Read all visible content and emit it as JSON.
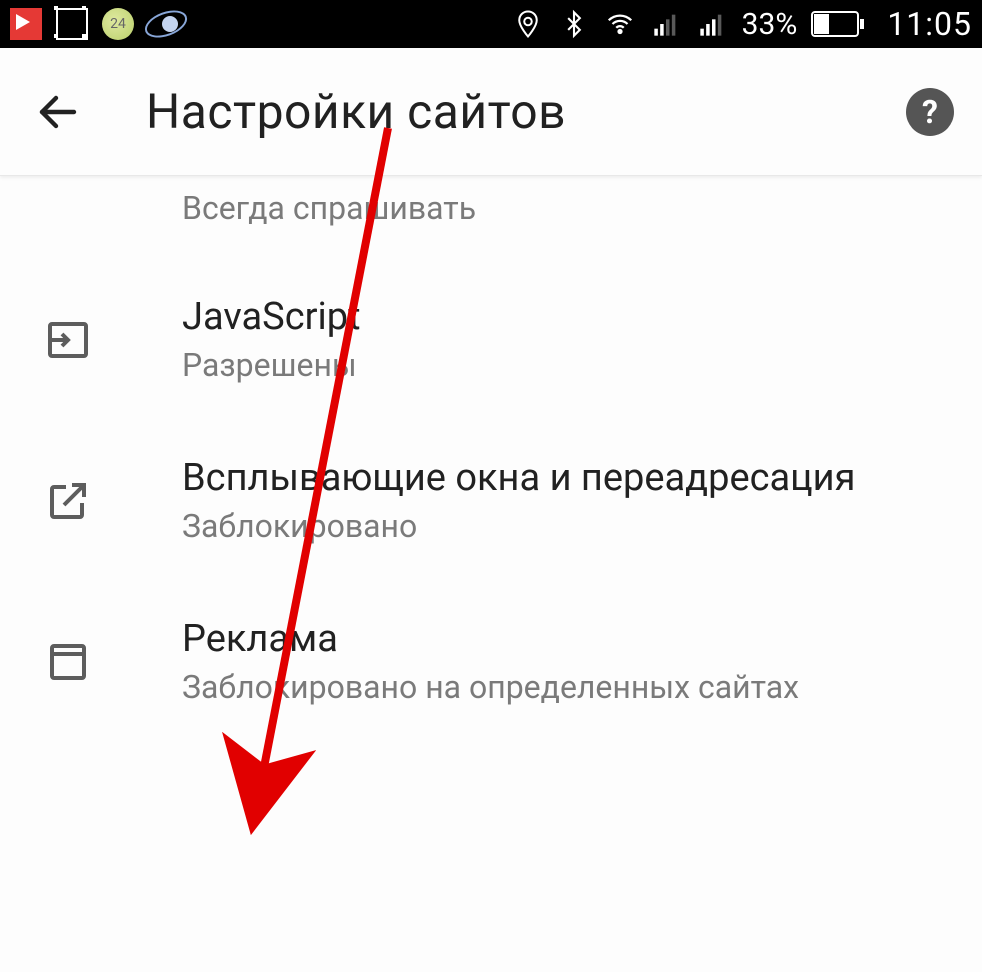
{
  "status_bar": {
    "battery_pct": "33%",
    "time": "11:05",
    "app3_label": "24"
  },
  "header": {
    "title": "Настройки сайтов"
  },
  "items": {
    "prev_sub": "Всегда спрашивать",
    "js": {
      "title": "JavaScript",
      "sub": "Разрешены"
    },
    "popups": {
      "title": "Всплывающие окна и переадресация",
      "sub": "Заблокировано"
    },
    "ads": {
      "title": "Реклама",
      "sub": "Заблокировано на определенных сайтах"
    }
  }
}
